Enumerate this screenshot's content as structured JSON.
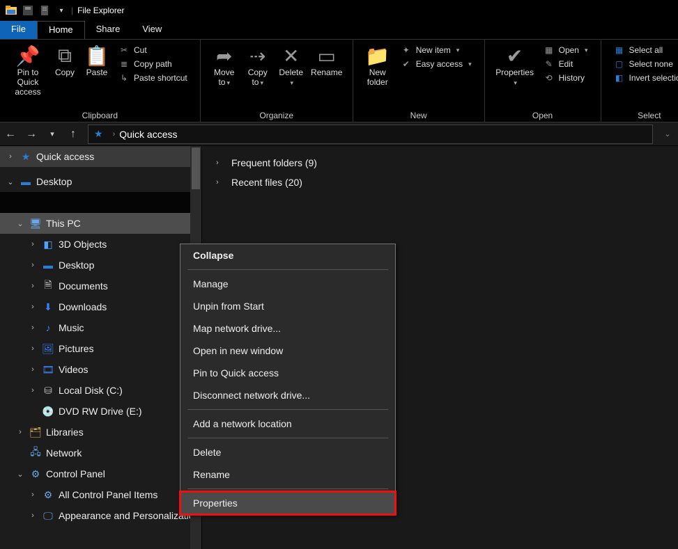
{
  "title": "File Explorer",
  "menutabs": {
    "file": "File",
    "home": "Home",
    "share": "Share",
    "view": "View"
  },
  "ribbon": {
    "clipboard": {
      "label": "Clipboard",
      "pin": "Pin to Quick access",
      "copy": "Copy",
      "paste": "Paste",
      "cut": "Cut",
      "copypath": "Copy path",
      "pasteshortcut": "Paste shortcut"
    },
    "organize": {
      "label": "Organize",
      "moveto": "Move to",
      "copyto": "Copy to",
      "delete": "Delete",
      "rename": "Rename"
    },
    "new": {
      "label": "New",
      "newfolder": "New folder",
      "newitem": "New item",
      "easyaccess": "Easy access"
    },
    "open": {
      "label": "Open",
      "properties": "Properties",
      "open": "Open",
      "edit": "Edit",
      "history": "History"
    },
    "select": {
      "label": "Select",
      "all": "Select all",
      "none": "Select none",
      "invert": "Invert selection"
    }
  },
  "address": {
    "location": "Quick access"
  },
  "sidebar": {
    "quickaccess": "Quick access",
    "desktop": "Desktop",
    "thispc": "This PC",
    "thispc_children": {
      "objects3d": "3D Objects",
      "desktop": "Desktop",
      "documents": "Documents",
      "downloads": "Downloads",
      "music": "Music",
      "pictures": "Pictures",
      "videos": "Videos",
      "localdisk": "Local Disk (C:)",
      "dvd": "DVD RW Drive (E:)"
    },
    "libraries": "Libraries",
    "network": "Network",
    "controlpanel": "Control Panel",
    "cp_children": {
      "allitems": "All Control Panel Items",
      "appearance": "Appearance and Personalization"
    }
  },
  "content": {
    "frequent": "Frequent folders (9)",
    "recent": "Recent files (20)"
  },
  "context_menu": {
    "collapse": "Collapse",
    "manage": "Manage",
    "unpin": "Unpin from Start",
    "mapdrive": "Map network drive...",
    "newwindow": "Open in new window",
    "pinquick": "Pin to Quick access",
    "disconnect": "Disconnect network drive...",
    "addloc": "Add a network location",
    "delete": "Delete",
    "rename": "Rename",
    "properties": "Properties"
  }
}
